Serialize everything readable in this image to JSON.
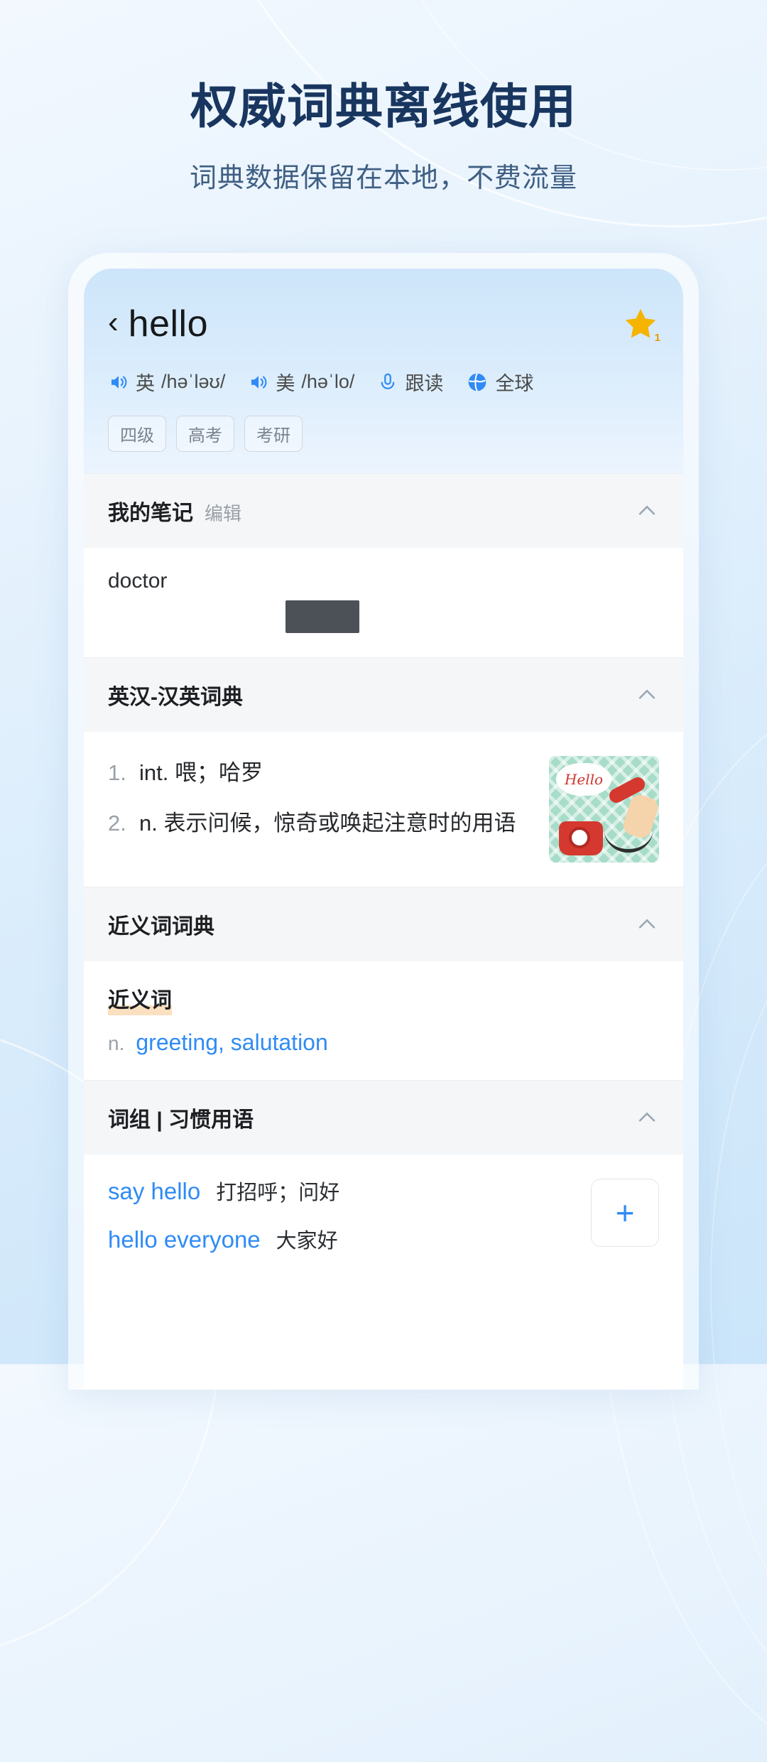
{
  "hero": {
    "title": "权威词典离线使用",
    "subtitle": "词典数据保留在本地，不费流量"
  },
  "colors": {
    "accent_blue": "#2f8bf5",
    "title_navy": "#18365f",
    "star_yellow": "#f5b400",
    "highlight_orange": "#fbe0c0"
  },
  "app": {
    "header": {
      "back_icon": "chevron-left-icon",
      "headword": "hello",
      "favorite_icon": "star-icon",
      "favorite_badge": "1"
    },
    "pronunciations": [
      {
        "icon": "speaker-icon",
        "region": "英",
        "ipa": "/həˈləʊ/"
      },
      {
        "icon": "speaker-icon",
        "region": "美",
        "ipa": "/həˈlo/"
      }
    ],
    "actions": [
      {
        "icon": "microphone-icon",
        "label": "跟读"
      },
      {
        "icon": "globe-icon",
        "label": "全球"
      }
    ],
    "tags": [
      "四级",
      "高考",
      "考研"
    ],
    "sections": [
      {
        "id": "my-notes",
        "title": "我的笔记",
        "action": "编辑",
        "collapse_icon": "chevron-up-icon",
        "note": "doctor"
      },
      {
        "id": "ec-ce-dictionary",
        "title": "英汉-汉英词典",
        "collapse_icon": "chevron-up-icon",
        "definitions": [
          {
            "num": "1.",
            "pos": "int.",
            "text": "喂；哈罗"
          },
          {
            "num": "2.",
            "pos": "n.",
            "text": "表示问候，惊奇或唤起注意时的用语"
          }
        ],
        "thumbnail_caption": "Hello",
        "thumbnail_name": "hello-telephone-illustration"
      },
      {
        "id": "synonym-dictionary",
        "title": "近义词词典",
        "collapse_icon": "chevron-up-icon",
        "subhead": "近义词",
        "entry_pos": "n.",
        "entry_words": "greeting, salutation"
      },
      {
        "id": "phrases",
        "title": "词组 | 习惯用语",
        "collapse_icon": "chevron-up-icon",
        "add_button": "+",
        "rows": [
          {
            "en": "say hello",
            "cn": "打招呼；问好"
          },
          {
            "en": "hello everyone",
            "cn": "大家好"
          }
        ]
      }
    ]
  }
}
